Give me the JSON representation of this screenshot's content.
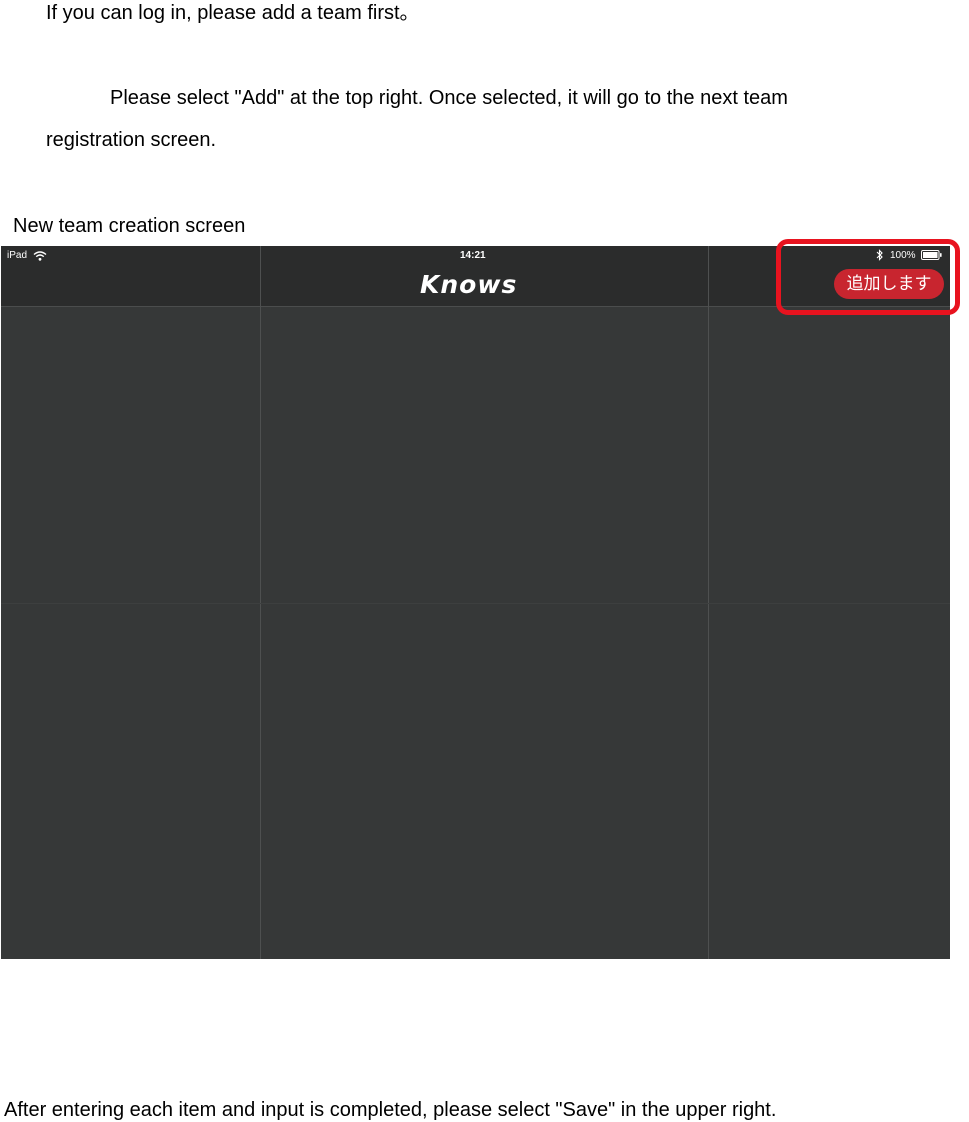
{
  "intro": {
    "text": "If you can log in, please add a team first。"
  },
  "instruction": {
    "line1": "Please select \"Add\" at the top right. Once selected, it will go to the next team",
    "line2": "registration screen."
  },
  "caption": "New team creation screen",
  "screenshot": {
    "status_bar": {
      "device": "iPad",
      "wifi_icon": "wifi-icon",
      "time": "14:21",
      "bluetooth_icon": "bluetooth-icon",
      "battery": "100%",
      "battery_icon": "battery-icon"
    },
    "nav_bar": {
      "logo": "Knows",
      "add_button": "追加します"
    },
    "colors": {
      "background": "#363838",
      "bar": "#2b2c2c",
      "button": "#c8252f",
      "highlight": "#e8131f"
    }
  },
  "footer": {
    "text": "After entering each item and input is completed, please select \"Save\" in the upper right."
  }
}
